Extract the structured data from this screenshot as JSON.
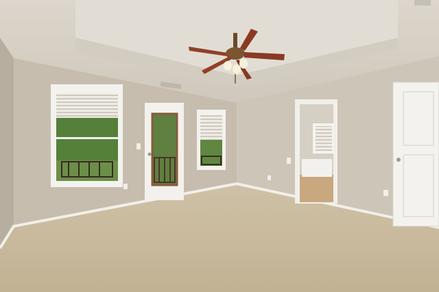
{
  "scene": {
    "subject": "empty-bedroom-interior",
    "colors": {
      "wall": "#c9c0b2",
      "wall_shadow": "#b3aa9c",
      "ceiling": "#d8d2c8",
      "tray": "#e4dfd6",
      "carpet": "#c9b99d",
      "trim": "#f3f1ec",
      "door": "#f2f1ee",
      "foliage": "#4f7a33",
      "blade": "#8a3a22"
    }
  }
}
